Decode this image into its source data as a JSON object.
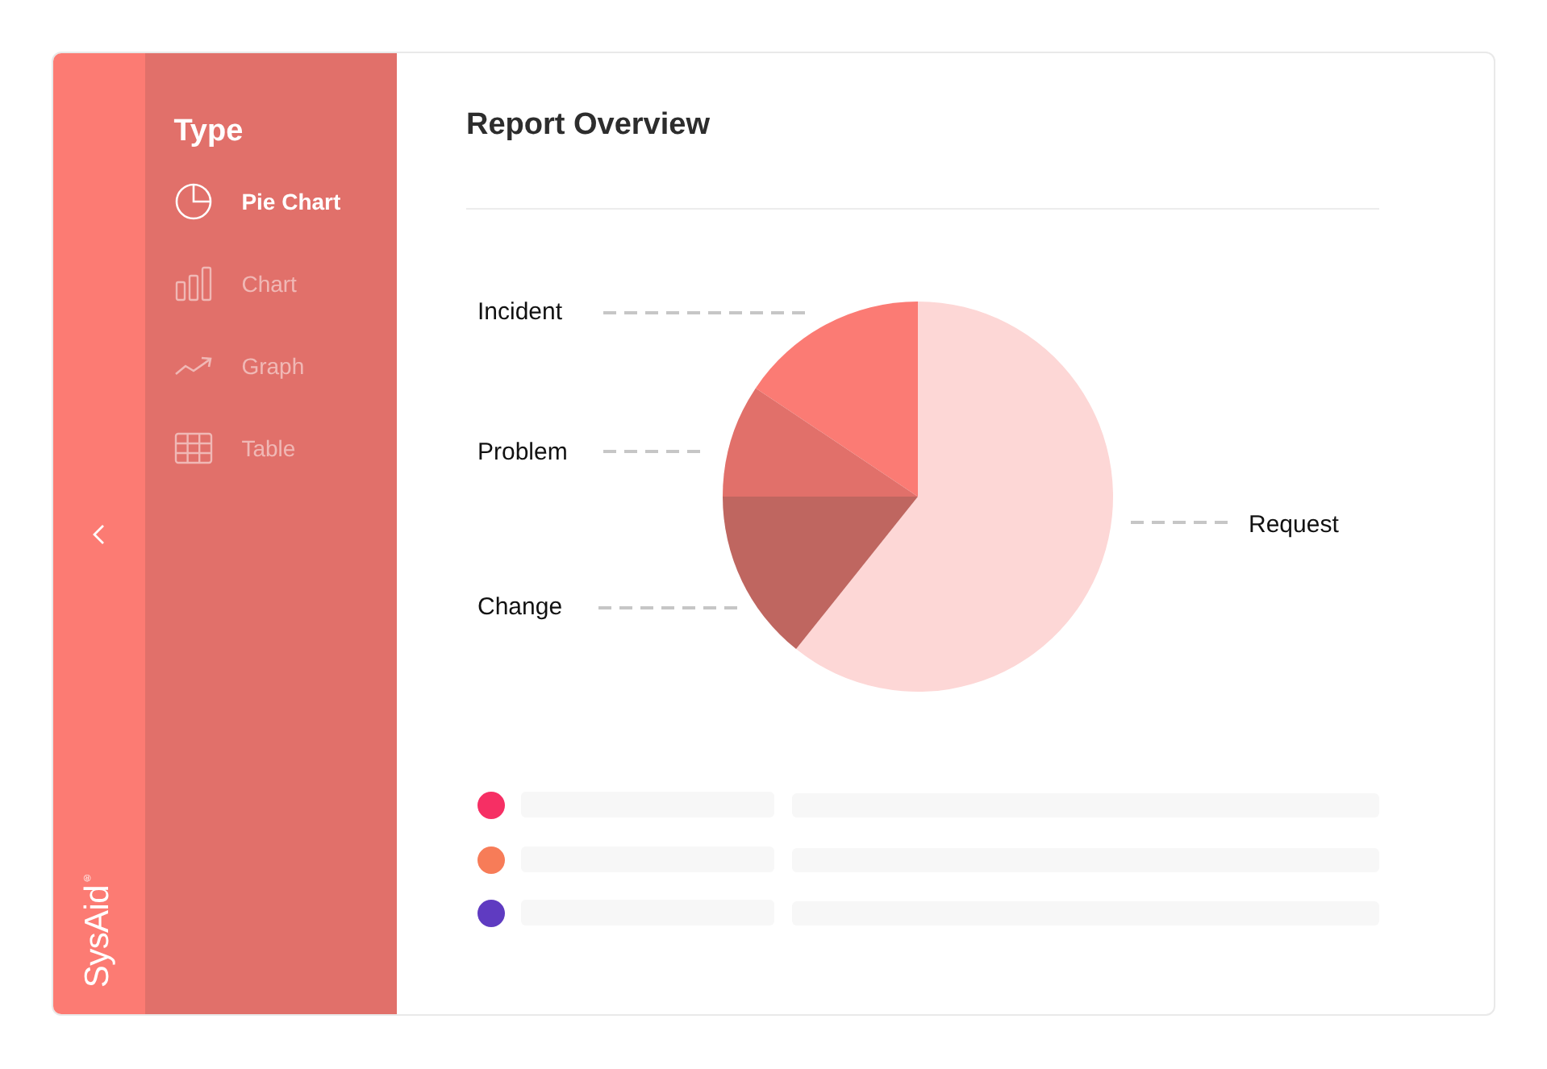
{
  "strip": {
    "logo": {
      "text": "SysAid",
      "mark": "®"
    }
  },
  "sidebar": {
    "title": "Type",
    "items": [
      {
        "label": "Pie Chart",
        "selected": true
      },
      {
        "label": "Chart",
        "selected": false
      },
      {
        "label": "Graph",
        "selected": false
      },
      {
        "label": "Table",
        "selected": false
      }
    ]
  },
  "report": {
    "title": "Report Overview",
    "chart": {
      "slices": [
        {
          "label": "Incident",
          "color": "#fb7b74"
        },
        {
          "label": "Problem",
          "color": "#e1706a"
        },
        {
          "label": "Request",
          "color": "#fdd7d6"
        },
        {
          "label": "Change",
          "color": "#bf6660"
        }
      ]
    },
    "legend": [
      {
        "color": "#f62f64"
      },
      {
        "color": "#f77c58"
      },
      {
        "color": "#5f3bc1"
      }
    ]
  }
}
